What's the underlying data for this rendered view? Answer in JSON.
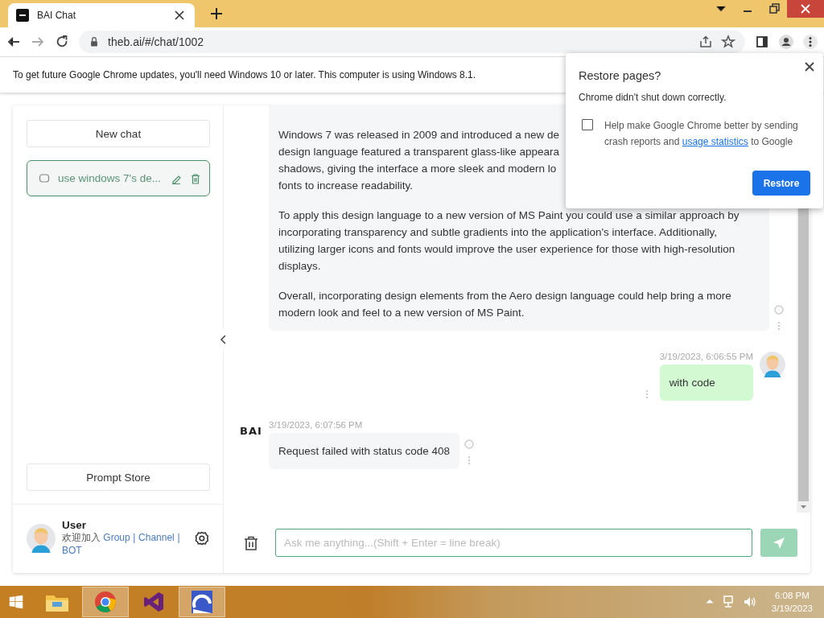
{
  "browser": {
    "tabs": [
      {
        "title": "BAI Chat",
        "selected": true
      }
    ],
    "address": "theb.ai/#/chat/1002"
  },
  "info_bar": {
    "text": "To get future Google Chrome updates, you'll need Windows 10 or later. This computer is using Windows 8.1."
  },
  "sidebar": {
    "new_chat": "New chat",
    "chats": [
      {
        "title": "use windows 7's de...",
        "selected": true
      }
    ],
    "prompt_store": "Prompt Store",
    "user": {
      "name": "User",
      "welcome": "欢迎加入",
      "links": [
        "Group",
        "Channel",
        "BOT"
      ],
      "separator": "|"
    }
  },
  "messages": [
    {
      "kind": "bot",
      "paragraphs": [
        [
          "Windows 7 was released in 2009 and introduced a new de",
          "design language featured a transparent glass-like appeara",
          "shadows, giving the interface a more sleek and modern lo",
          "fonts to increase readability."
        ],
        [
          "To apply this design language to a new version of MS Paint you could use a similar approach by",
          "incorporating transparency and subtle gradients into the application's interface. Additionally,",
          "utilizing larger icons and fonts would improve the user experience for those with high-resolution",
          "displays."
        ],
        [
          "Overall, incorporating design elements from the Aero design language could help bring a more",
          "modern look and feel to a new version of MS Paint."
        ]
      ]
    },
    {
      "kind": "user",
      "time": "3/19/2023, 6:06:55 PM",
      "paragraphs": [
        [
          "with code"
        ]
      ]
    },
    {
      "kind": "bot",
      "avatar": "BAI",
      "time": "3/19/2023, 6:07:56 PM",
      "paragraphs": [
        [
          "Request failed with status code 408"
        ]
      ]
    }
  ],
  "input": {
    "placeholder": "Ask me anything...(Shift + Enter = line break)"
  },
  "popup": {
    "title": "Restore pages?",
    "message": "Chrome didn't shut down correctly.",
    "checkbox": {
      "checked": false,
      "label_before": "Help make Google Chrome better by sending crash reports and",
      "link": "usage statistics",
      "label_after": "to Google"
    },
    "button": "Restore"
  },
  "taskbar": {
    "apps": [
      {
        "kind": "explorer",
        "selected": false
      },
      {
        "kind": "chrome",
        "selected": true
      },
      {
        "kind": "vs",
        "selected": false
      },
      {
        "kind": "arc",
        "selected": true
      }
    ],
    "time": "6:08 PM",
    "date": "3/19/2023"
  }
}
